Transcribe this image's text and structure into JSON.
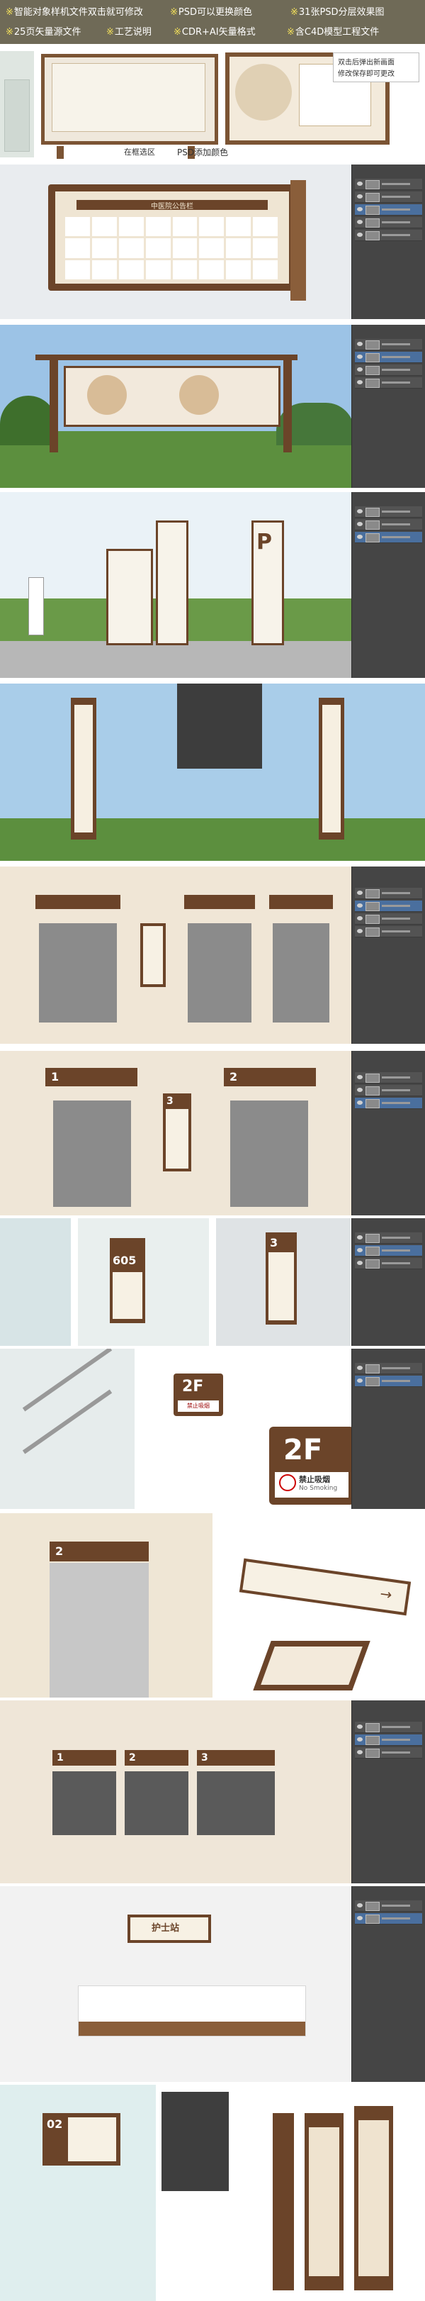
{
  "features": [
    {
      "mark": "※",
      "text": "智能对象样机文件双击就可修改"
    },
    {
      "mark": "※",
      "text": "PSD可以更换颜色"
    },
    {
      "mark": "※",
      "text": "31张PSD分层效果图"
    },
    {
      "mark": "※",
      "text": "25页矢量源文件"
    },
    {
      "mark": "※",
      "text": "工艺说明"
    },
    {
      "mark": "※",
      "text": "CDR+AI矢量格式"
    },
    {
      "mark": "※",
      "text": "含C4D模型工程文件"
    }
  ],
  "captions": {
    "psd_color": "PSD添加颜色",
    "smart_object_top": "双击后弹出新画面",
    "smart_object_bottom": "修改保存即可更改",
    "left_small": "在框选区"
  },
  "signs": {
    "board_title": "中医院公告栏",
    "floor_label": "2F",
    "no_smoking": "禁止吸烟",
    "no_smoking_en": "No Smoking",
    "room_605": "605",
    "direction_arrow": "→",
    "hanging_sign": "护士站",
    "elevator_num_1": "1",
    "elevator_num_2": "2",
    "elevator_num_3": "3",
    "window_1": "1",
    "window_2": "2",
    "window_3": "3",
    "parking": "P",
    "floor_02": "02"
  },
  "colors": {
    "banner_bg": "#6f6a57",
    "feature_mark": "#f4e15a",
    "wood": "#6b4429",
    "gold": "#c69a5b",
    "ps_panel": "#454545"
  }
}
